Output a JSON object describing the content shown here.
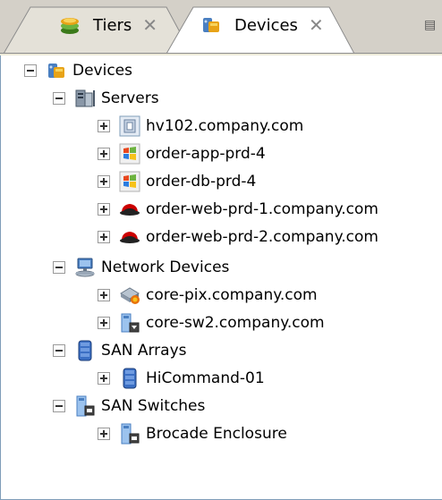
{
  "tabs": [
    {
      "label": "Tiers",
      "icon": "tiers-icon",
      "active": false
    },
    {
      "label": "Devices",
      "icon": "devices-icon",
      "active": true
    }
  ],
  "tree": {
    "root": {
      "label": "Devices"
    },
    "servers": {
      "label": "Servers",
      "items": [
        {
          "label": "hv102.company.com",
          "icon": "hypervisor-icon"
        },
        {
          "label": "order-app-prd-4",
          "icon": "windows-icon"
        },
        {
          "label": "order-db-prd-4",
          "icon": "windows-icon"
        },
        {
          "label": "order-web-prd-1.company.com",
          "icon": "redhat-icon"
        },
        {
          "label": "order-web-prd-2.company.com",
          "icon": "redhat-icon"
        }
      ]
    },
    "network": {
      "label": "Network Devices",
      "items": [
        {
          "label": "core-pix.company.com",
          "icon": "firewall-icon"
        },
        {
          "label": "core-sw2.company.com",
          "icon": "switch-icon"
        }
      ]
    },
    "san_arrays": {
      "label": "SAN Arrays",
      "items": [
        {
          "label": "HiCommand-01",
          "icon": "storage-array-icon"
        }
      ]
    },
    "san_switches": {
      "label": "SAN Switches",
      "items": [
        {
          "label": "Brocade Enclosure",
          "icon": "san-switch-icon"
        }
      ]
    }
  }
}
